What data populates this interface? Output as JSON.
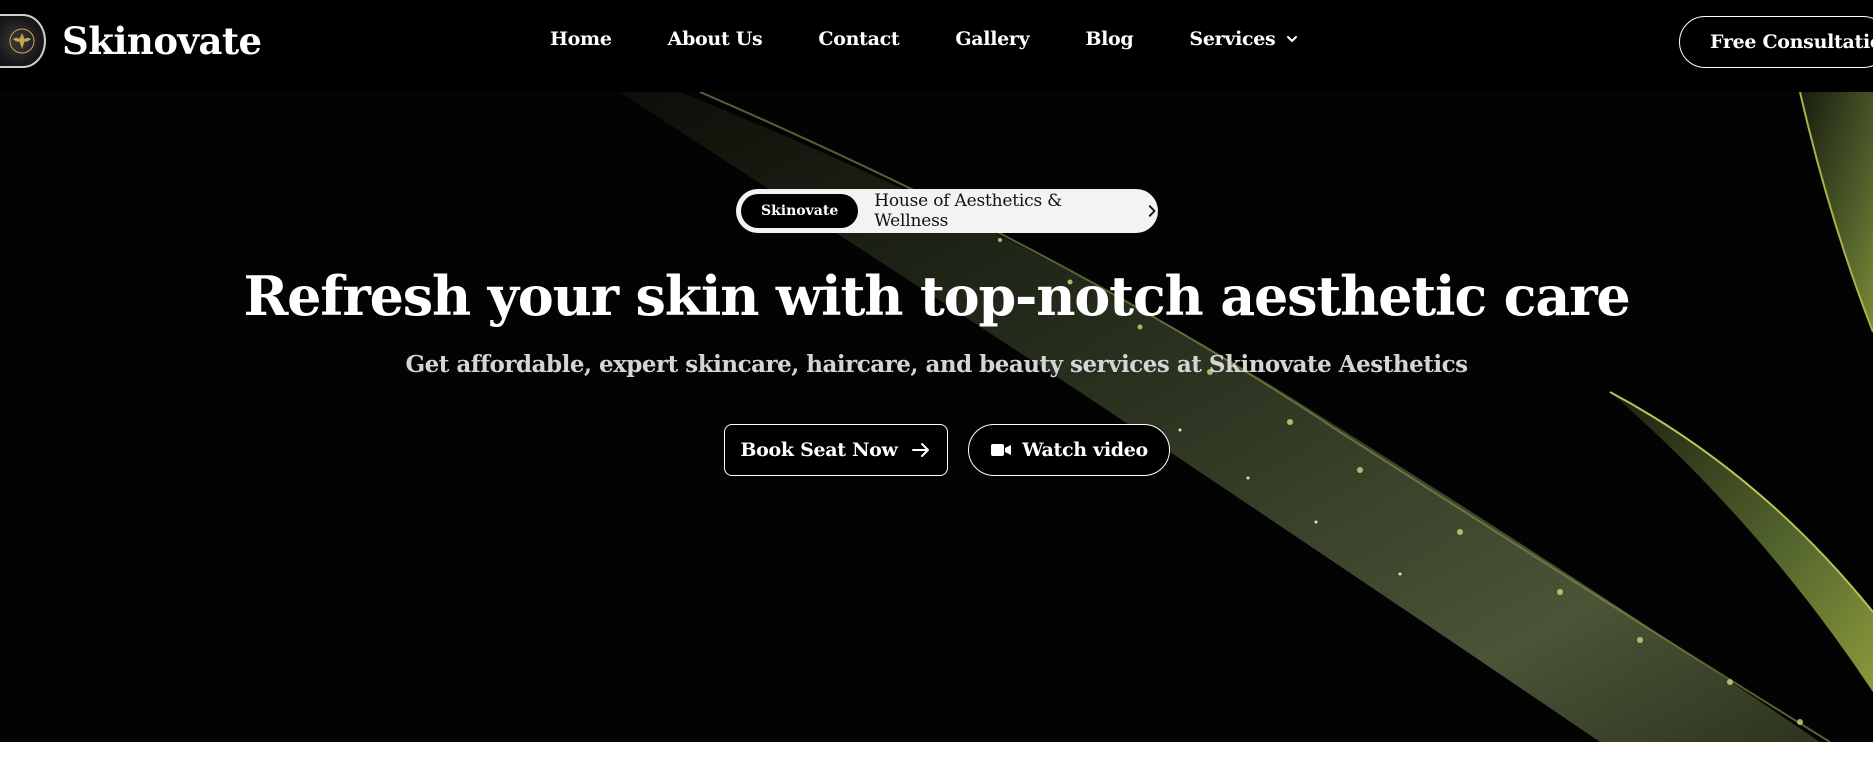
{
  "header": {
    "brand": "Skinovate",
    "logo_icon": "seal-emblem-icon",
    "nav": [
      {
        "label": "Home"
      },
      {
        "label": "About Us"
      },
      {
        "label": "Contact"
      },
      {
        "label": "Gallery"
      },
      {
        "label": "Blog"
      },
      {
        "label": "Services",
        "icon": "chevron-down-icon"
      }
    ],
    "cta_label": "Free Consultation"
  },
  "hero": {
    "pill_badge": "Skinovate",
    "pill_text": "House of Aesthetics & Wellness",
    "pill_icon": "chevron-right-icon",
    "headline": "Refresh your skin with top-notch aesthetic care",
    "subline": "Get affordable, expert skincare, haircare, and beauty services at Skinovate Aesthetics",
    "primary_button": "Book Seat Now",
    "primary_button_icon": "arrow-right-icon",
    "secondary_button": "Watch video",
    "secondary_button_icon": "video-camera-icon"
  },
  "colors": {
    "background": "#000000",
    "text": "#ffffff",
    "subtext": "#d4d4d4",
    "pill_bg": "#f3f3f3",
    "leaf": "#5a6a3a"
  }
}
